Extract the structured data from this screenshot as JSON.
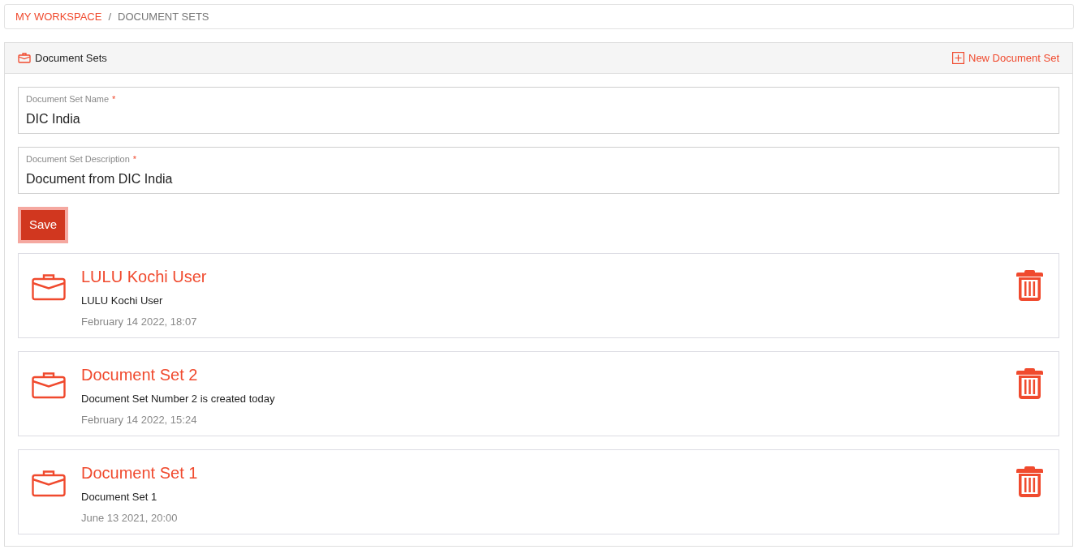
{
  "breadcrumb": [
    {
      "label": "MY WORKSPACE",
      "link": true
    },
    {
      "label": "/",
      "link": false
    },
    {
      "label": "DOCUMENT SETS",
      "link": false
    }
  ],
  "panel": {
    "title": "Document Sets",
    "action": "New Document Set"
  },
  "form": {
    "fields": [
      {
        "label": "Document Set Name",
        "required_mark": "*",
        "value": "DIC India"
      },
      {
        "label": "Document Set Description",
        "required_mark": "*",
        "value": "Document from DIC India"
      }
    ],
    "save": "Save"
  },
  "document_sets": [
    {
      "title": "LULU Kochi User",
      "description": "LULU Kochi User",
      "date": "February 14 2022, 18:07"
    },
    {
      "title": "Document Set 2",
      "description": "Document Set Number 2 is created today",
      "date": "February 14 2022, 15:24"
    },
    {
      "title": "Document Set 1",
      "description": "Document Set 1",
      "date": "June 13 2021, 20:00"
    }
  ]
}
